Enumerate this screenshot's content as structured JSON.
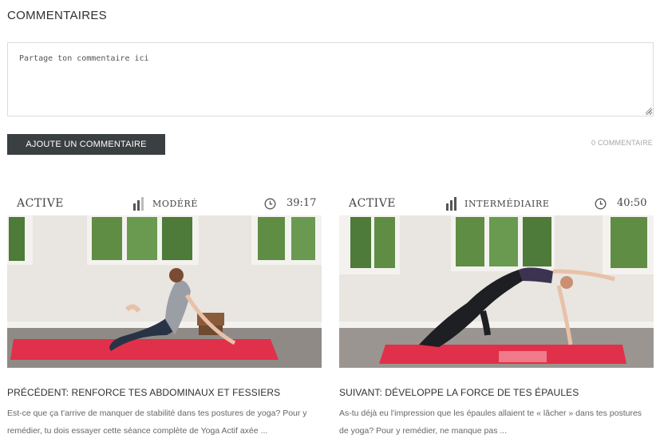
{
  "comments": {
    "title": "COMMENTAIRES",
    "placeholder": "Partage ton commentaire ici",
    "submit_label": "AJOUTE UN COMMENTAIRE",
    "count_label": "0 COMMENTAIRE"
  },
  "cards": [
    {
      "category": "ACTIVE",
      "level": "MODÉRÉ",
      "duration": "39:17",
      "title": "PRÉCÉDENT: RENFORCE TES ABDOMINAUX ET FESSIERS",
      "excerpt_line1": "Est-ce que ça t'arrive de manquer de stabilité dans tes postures de yoga? Pour y",
      "excerpt_line2": "remédier, tu dois essayer cette séance complète de Yoga Actif axée ..."
    },
    {
      "category": "ACTIVE",
      "level": "INTERMÉDIAIRE",
      "duration": "40:50",
      "title": "SUIVANT: DÉVELOPPE LA FORCE DE TES ÉPAULES",
      "excerpt_line1": "As-tu déjà eu l'impression que les épaules allaient te « lâcher » dans tes postures",
      "excerpt_line2": "de yoga? Pour y remédier, ne manque pas ..."
    }
  ],
  "colors": {
    "button_bg": "#3a3f41",
    "mat": "#e0304a",
    "wall": "#e9e5e0"
  },
  "icons": [
    "level-bars-icon",
    "clock-icon"
  ]
}
